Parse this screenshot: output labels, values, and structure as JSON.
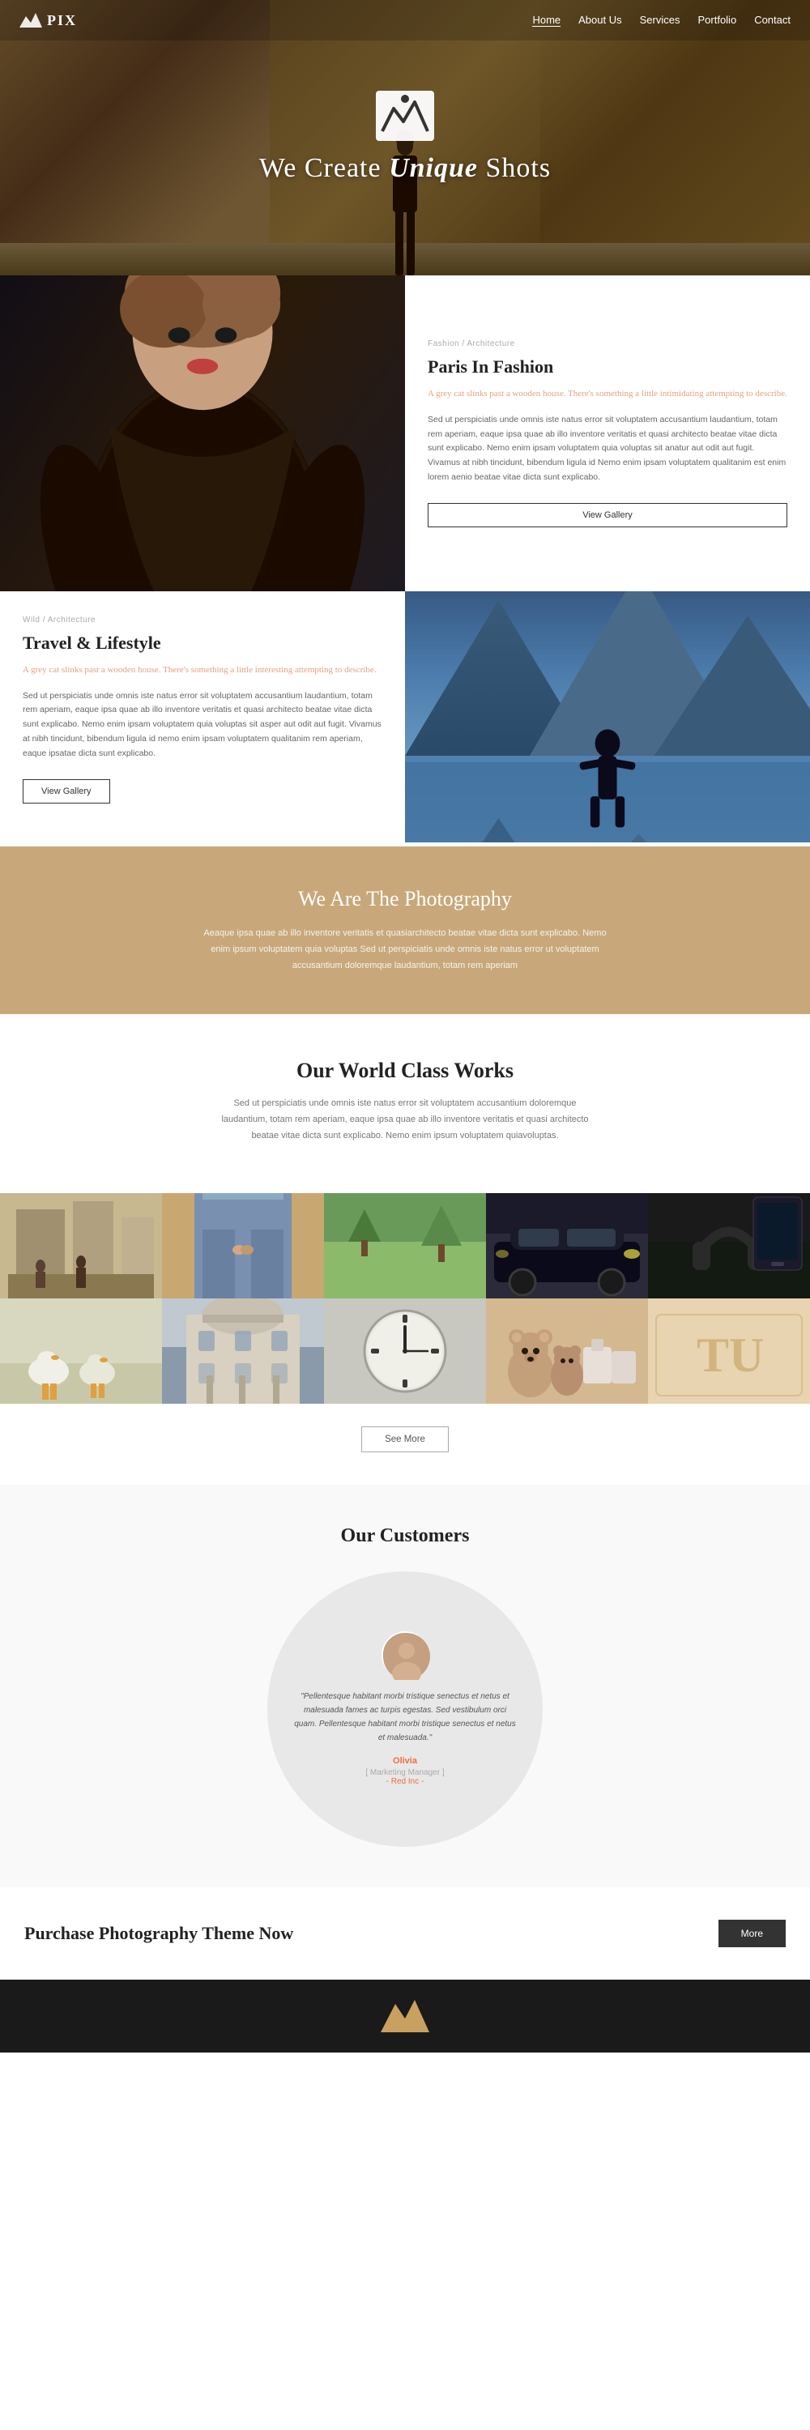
{
  "nav": {
    "logo": "PIX",
    "links": [
      {
        "label": "Home",
        "active": true
      },
      {
        "label": "About Us",
        "active": false
      },
      {
        "label": "Services",
        "active": false
      },
      {
        "label": "Portfolio",
        "active": false
      },
      {
        "label": "Contact",
        "active": false
      }
    ]
  },
  "hero": {
    "title_start": "We Create ",
    "title_highlight": "Unique",
    "title_end": " Shots"
  },
  "fashion": {
    "tag": "Fashion / Architecture",
    "title": "Paris In Fashion",
    "subtitle": "A grey cat slinks past a wooden house. There's something a little intimidating attempting to describe.",
    "desc": "Sed ut perspiciatis unde omnis iste natus error sit voluptatem accusantium laudantium, totam rem aperiam, eaque ipsa quae ab illo inventore veritatis et quasi architecto beatae vitae dicta sunt explicabo. Nemo enim ipsam voluptatem quia voluptas sit anatur aut odit aut fugit. Vivamus at nibh tincidunt, bibendum ligula id Nemo enim ipsam voluptatem qualitanim est enim lorem aenio beatae vitae dicta sunt explicabo.",
    "btn": "View Gallery"
  },
  "travel": {
    "tag": "Wild / Architecture",
    "title": "Travel & Lifestyle",
    "subtitle": "A grey cat slinks past a wooden house. There's something a little interesting attempting to describe.",
    "desc": "Sed ut perspiciatis unde omnis iste natus error sit voluptatem accusantium laudantium, totam rem aperiam, eaque ipsa quae ab illo inventore veritatis et quasi architecto beatae vitae dicta sunt explicabo. Nemo enim ipsam voluptatem quia voluptas sit asper aut odit aut fugit. Vivamus at nibh tincidunt, bibendum ligula id nemo enim ipsam voluptatem qualitanim rem aperiam, eaque ipsatae dicta sunt explicabo.",
    "btn": "View Gallery"
  },
  "photography_banner": {
    "title": "We Are The Photography",
    "desc": "Aeaque ipsa quae ab illo inventore veritatis et quasiarchitecto beatae vitae dicta sunt explicabo. Nemo enim ipsum voluptatem quia voluptas Sed ut perspiciatis unde omnis iste natus error ut voluptatem accusantium doloremque laudantium, totam rem aperiam"
  },
  "works": {
    "title": "Our World Class Works",
    "desc": "Sed ut perspiciatis unde omnis iste natus error sit voluptatem accusantium doloremque laudantium, totam rem aperiam, eaque ipsa quae ab illo inventore veritatis et quasi architecto beatae vitae dicta sunt explicabo. Nemo enim ipsum voluptatem quiavoluptas."
  },
  "gallery": {
    "cells": [
      {
        "id": 1,
        "class": "g1"
      },
      {
        "id": 2,
        "class": "g2"
      },
      {
        "id": 3,
        "class": "g3"
      },
      {
        "id": 4,
        "class": "g4"
      },
      {
        "id": 5,
        "class": "g5"
      },
      {
        "id": 6,
        "class": "g6"
      },
      {
        "id": 7,
        "class": "g7"
      },
      {
        "id": 8,
        "class": "g8"
      },
      {
        "id": 9,
        "class": "g9"
      },
      {
        "id": 10,
        "class": "g10"
      }
    ],
    "see_more_btn": "See More"
  },
  "customers": {
    "title": "Our Customers",
    "quote": "\"Pellentesque habitant morbi tristique senectus et netus et malesuada fames ac turpis egestas. Sed vestibulum orci quam. Pellentesque habitant morbi tristique senectus et netus et malesuada.\"",
    "name": "Olivia",
    "role": "[ Marketing Manager ]",
    "company": "- Red Inc -"
  },
  "purchase": {
    "title": "Purchase Photography Theme Now",
    "btn": "More"
  },
  "footer": {}
}
